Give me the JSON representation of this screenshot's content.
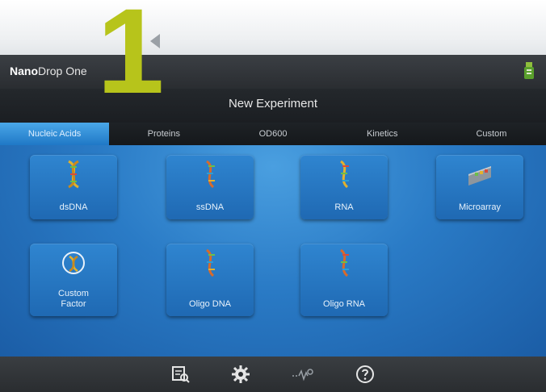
{
  "callout": {
    "step_number": "1"
  },
  "app": {
    "brand_bold": "Nano",
    "brand_rest": "Drop One",
    "usb_icon": "usb-drive-icon"
  },
  "header": {
    "title": "New Experiment"
  },
  "tabs": [
    {
      "label": "Nucleic Acids",
      "active": true
    },
    {
      "label": "Proteins",
      "active": false
    },
    {
      "label": "OD600",
      "active": false
    },
    {
      "label": "Kinetics",
      "active": false
    },
    {
      "label": "Custom",
      "active": false
    }
  ],
  "tiles": [
    {
      "label": "dsDNA",
      "icon": "dna-helix-icon"
    },
    {
      "label": "ssDNA",
      "icon": "dna-strand-icon"
    },
    {
      "label": "RNA",
      "icon": "rna-strand-icon"
    },
    {
      "label": "Microarray",
      "icon": "microarray-chip-icon"
    },
    {
      "label": "Custom\nFactor",
      "icon": "custom-factor-icon"
    },
    {
      "label": "Oligo DNA",
      "icon": "oligo-dna-icon"
    },
    {
      "label": "Oligo RNA",
      "icon": "oligo-rna-icon"
    }
  ],
  "toolbar": {
    "icons": [
      "data-viewer-icon",
      "settings-gear-icon",
      "diagnostics-icon",
      "help-icon"
    ]
  },
  "colors": {
    "callout": "#b7c41b",
    "active_tab": "#2f8ad6",
    "content_blue": "#2a7bc6",
    "tile_blue": "#2f85d0"
  }
}
